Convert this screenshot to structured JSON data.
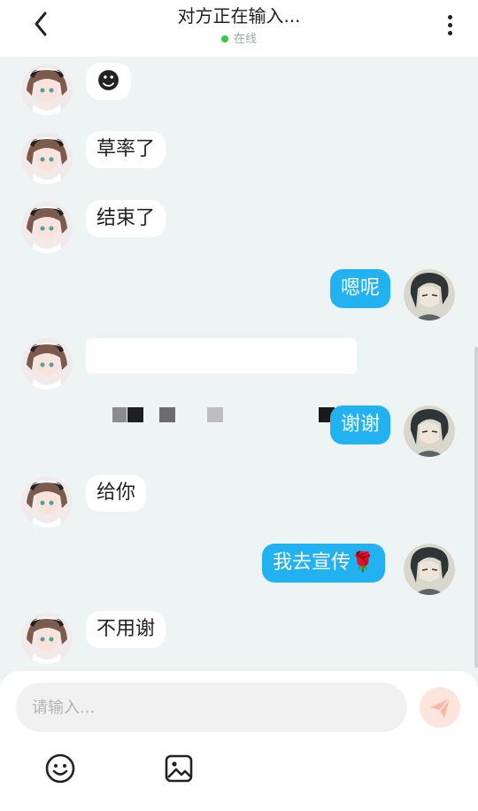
{
  "header": {
    "title": "对方正在输入...",
    "status": "在线",
    "status_color": "#2ecc40"
  },
  "messages": [
    {
      "side": "in",
      "text": "☻"
    },
    {
      "side": "in",
      "text": "草率了"
    },
    {
      "side": "in",
      "text": "结束了"
    },
    {
      "side": "out",
      "text": "嗯呢"
    },
    {
      "side": "in",
      "text": "",
      "redacted": true
    },
    {
      "side": "out",
      "text": "谢谢"
    },
    {
      "side": "in",
      "text": "给你"
    },
    {
      "side": "out",
      "text": "我去宣传🌹"
    },
    {
      "side": "in",
      "text": "不用谢"
    }
  ],
  "composer": {
    "placeholder": "请输入...",
    "icons": [
      "emoji-icon",
      "image-icon",
      "send-icon"
    ]
  },
  "colors": {
    "outgoing_bubble": "#22b2f2",
    "incoming_bubble": "#ffffff",
    "chat_background": "#eef3f3"
  }
}
